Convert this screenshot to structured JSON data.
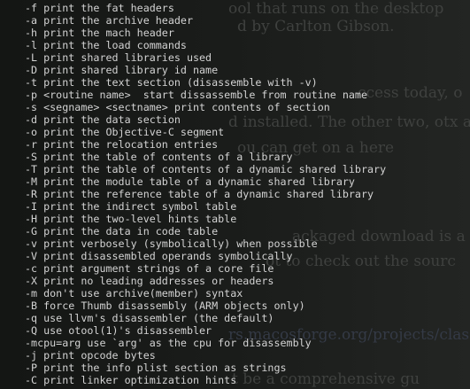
{
  "background_page": {
    "fragments": [
      "ool that runs on the desktop",
      "d by Carlton Gibson.",
      "ccess today, o",
      "d installed. The other two, otx and o",
      "ou can get on a here",
      "ackaged download is a bit m",
      "ot to check out the sourc",
      "rs.macosforge.org/projects/class-d",
      "t be a comprehensive gu"
    ]
  },
  "terminal": {
    "lines": [
      "-f print the fat headers",
      "-a print the archive header",
      "-h print the mach header",
      "-l print the load commands",
      "-L print shared libraries used",
      "-D print shared library id name",
      "-t print the text section (disassemble with -v)",
      "-p <routine name>  start dissassemble from routine name",
      "-s <segname> <sectname> print contents of section",
      "-d print the data section",
      "-o print the Objective-C segment",
      "-r print the relocation entries",
      "-S print the table of contents of a library",
      "-T print the table of contents of a dynamic shared library",
      "-M print the module table of a dynamic shared library",
      "-R print the reference table of a dynamic shared library",
      "-I print the indirect symbol table",
      "-H print the two-level hints table",
      "-G print the data in code table",
      "-v print verbosely (symbolically) when possible",
      "-V print disassembled operands symbolically",
      "-c print argument strings of a core file",
      "-X print no leading addresses or headers",
      "-m don't use archive(member) syntax",
      "-B force Thumb disassembly (ARM objects only)",
      "-q use llvm's disassembler (the default)",
      "-Q use otool(1)'s disassembler",
      "-mcpu=arg use `arg' as the cpu for disassembly",
      "-j print opcode bytes",
      "-P print the info plist section as strings",
      "-C print linker optimization hints"
    ]
  }
}
